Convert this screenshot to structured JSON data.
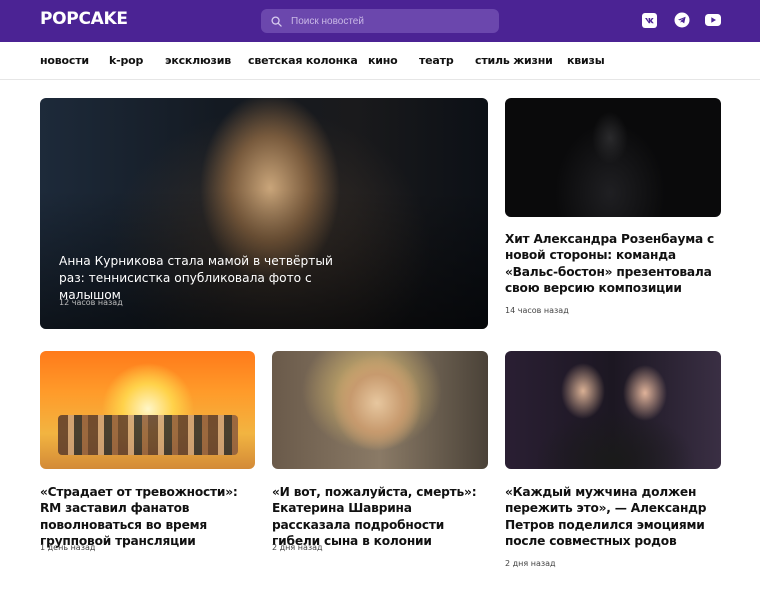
{
  "header": {
    "logo": "POPCAKE",
    "search_placeholder": "Поиск новостей",
    "social": [
      "vk-icon",
      "telegram-icon",
      "youtube-icon"
    ],
    "colors": {
      "brand": "#4b2394",
      "search_bg": "#6b47ad"
    }
  },
  "nav": {
    "items": [
      "новости",
      "k-pop",
      "эксклюзив",
      "светская колонка",
      "кино",
      "театр",
      "стиль жизни",
      "квизы"
    ]
  },
  "featured": {
    "title": "Анна Курникова стала мамой в четвёртый раз: теннисистка опубликовала фото с малышом",
    "time": "12 часов назад"
  },
  "articles": [
    {
      "title": "Хит Александра Розенбаума с новой стороны: команда «Вальс-бостон» презентовала свою версию композиции",
      "time": "14 часов назад"
    },
    {
      "title": "«Страдает от тревожности»: RM заставил фанатов поволноваться во время групповой трансляции",
      "time": "1 день назад"
    },
    {
      "title": "«И вот, пожалуйста, смерть»: Екатерина Шаврина рассказала подробности гибели сына в колонии",
      "time": "2 дня назад"
    },
    {
      "title": "«Каждый мужчина должен пережить это», — Александр Петров поделился эмоциями после совместных родов",
      "time": "2 дня назад"
    }
  ]
}
